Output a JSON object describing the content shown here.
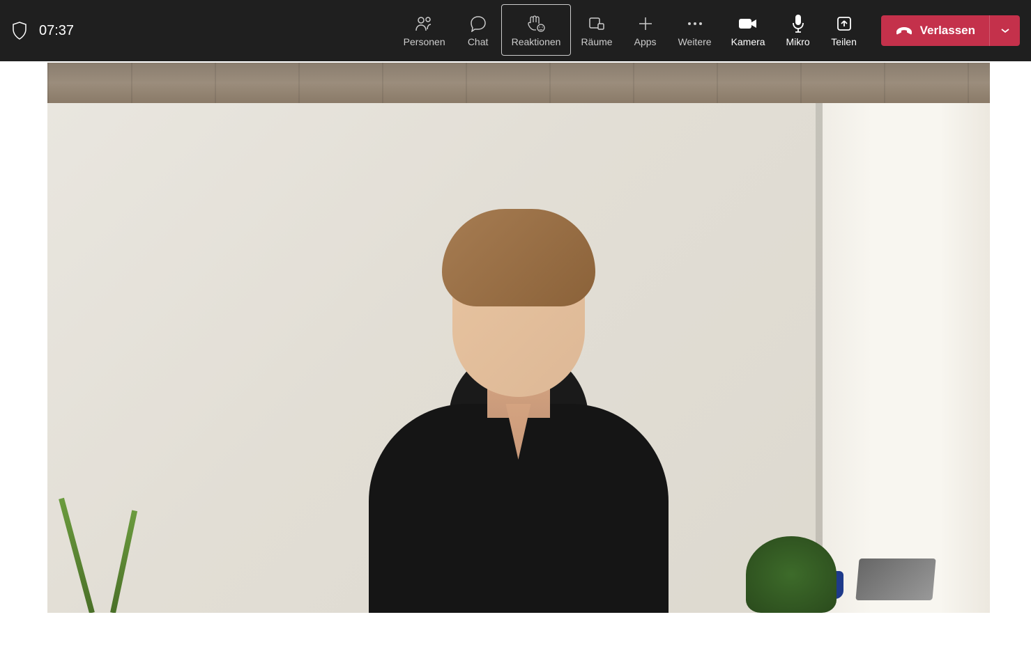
{
  "header": {
    "timer": "07:37"
  },
  "toolbar": {
    "personen": "Personen",
    "chat": "Chat",
    "reaktionen": "Reaktionen",
    "raeume": "Räume",
    "apps": "Apps",
    "weitere": "Weitere",
    "kamera": "Kamera",
    "mikro": "Mikro",
    "teilen": "Teilen"
  },
  "leave": {
    "label": "Verlassen"
  },
  "colors": {
    "toolbar_bg": "#1f1f1f",
    "leave_bg": "#c4314b"
  }
}
